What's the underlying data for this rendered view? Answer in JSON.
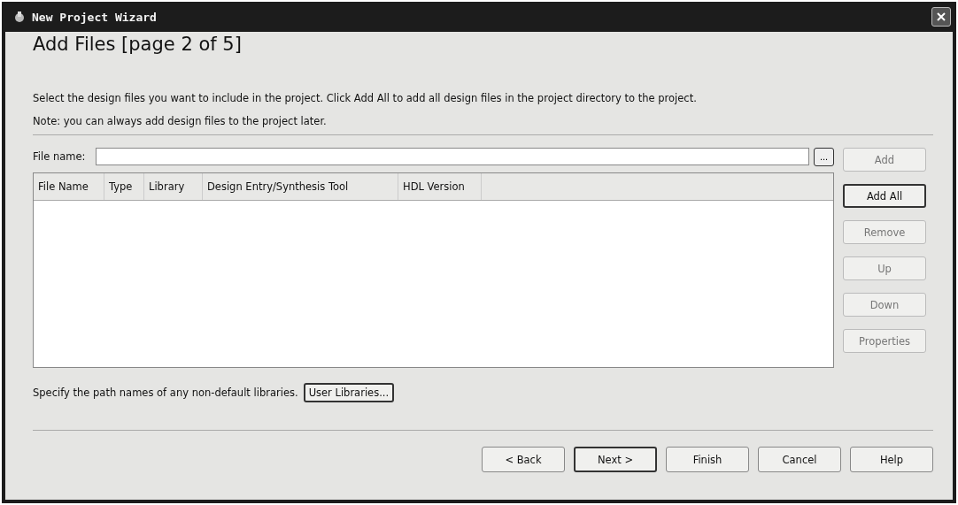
{
  "window": {
    "title": "New Project Wizard"
  },
  "heading": "Add Files [page 2 of 5]",
  "description": [
    "Select the design files you want to include in the project. Click Add All to add all design files in the project directory to the project.",
    "Note: you can always add design files to the project later."
  ],
  "file_name": {
    "label": "File name:",
    "browse": "..."
  },
  "side_buttons": [
    {
      "label": "Add",
      "disabled": true,
      "default": false
    },
    {
      "label": "Add All",
      "disabled": false,
      "default": true
    },
    {
      "label": "Remove",
      "disabled": true,
      "default": false
    },
    {
      "label": "Up",
      "disabled": true,
      "default": false
    },
    {
      "label": "Down",
      "disabled": true,
      "default": false
    },
    {
      "label": "Properties",
      "disabled": true,
      "default": false
    }
  ],
  "table": {
    "columns": [
      "File Name",
      "Type",
      "Library",
      "Design Entry/Synthesis Tool",
      "HDL Version"
    ]
  },
  "libraries": {
    "text": "Specify the path names of any non-default libraries.",
    "button": "User Libraries..."
  },
  "buttons": [
    {
      "label": "< Back",
      "default": false
    },
    {
      "label": "Next >",
      "default": true
    },
    {
      "label": "Finish",
      "default": false
    },
    {
      "label": "Cancel",
      "default": false
    },
    {
      "label": "Help",
      "default": false
    }
  ]
}
